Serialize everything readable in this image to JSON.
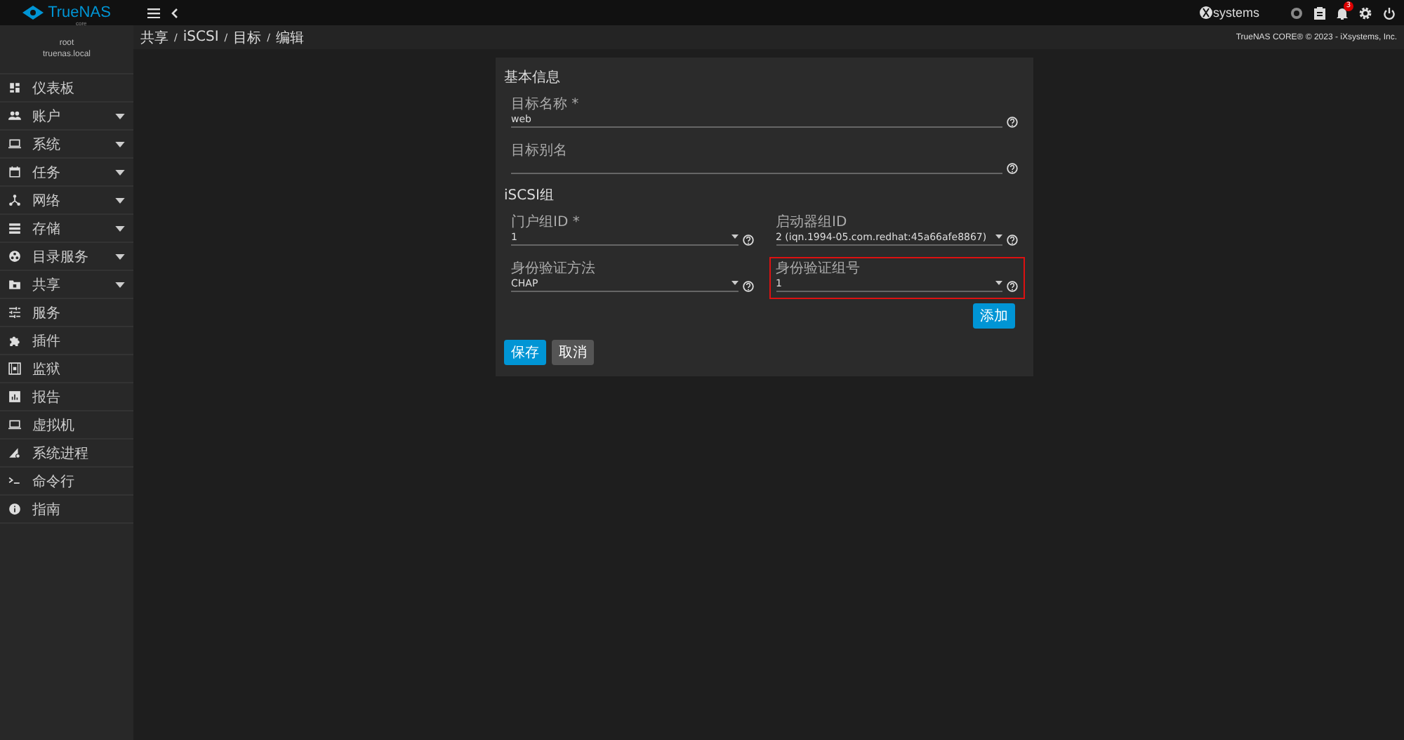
{
  "topbar": {
    "logo": "TrueNAS",
    "logo_sub": "core",
    "vendor": "systems",
    "notifications": "3"
  },
  "user": {
    "name": "root",
    "host": "truenas.local"
  },
  "sidebar": {
    "items": [
      {
        "label": "仪表板",
        "expandable": false
      },
      {
        "label": "账户",
        "expandable": true
      },
      {
        "label": "系统",
        "expandable": true
      },
      {
        "label": "任务",
        "expandable": true
      },
      {
        "label": "网络",
        "expandable": true
      },
      {
        "label": "存储",
        "expandable": true
      },
      {
        "label": "目录服务",
        "expandable": true
      },
      {
        "label": "共享",
        "expandable": true
      },
      {
        "label": "服务",
        "expandable": false
      },
      {
        "label": "插件",
        "expandable": false
      },
      {
        "label": "监狱",
        "expandable": false
      },
      {
        "label": "报告",
        "expandable": false
      },
      {
        "label": "虚拟机",
        "expandable": false
      },
      {
        "label": "系统进程",
        "expandable": false
      },
      {
        "label": "命令行",
        "expandable": false
      },
      {
        "label": "指南",
        "expandable": false
      }
    ]
  },
  "breadcrumb": [
    {
      "label": "共享",
      "separator": "/"
    },
    {
      "label": "iSCSI",
      "separator": "/"
    },
    {
      "label": "目标",
      "separator": "/"
    },
    {
      "label": "编辑"
    }
  ],
  "copyright": "TrueNAS CORE® © 2023 - iXsystems, Inc.",
  "form": {
    "sections": [
      {
        "title": "基本信息",
        "rows": [
          [
            {
              "label": "目标名称 *",
              "value": "web",
              "dropdown": false,
              "highlighted": false
            }
          ],
          [
            {
              "label": "目标别名",
              "dropdown": false,
              "highlighted": false
            }
          ]
        ]
      },
      {
        "title": "iSCSI组",
        "rows": [
          [
            {
              "label": "门户组ID *",
              "value": "1",
              "dropdown": true,
              "highlighted": false
            },
            {
              "label": "启动器组ID",
              "value": "2 (iqn.1994-05.com.redhat:45a66afe8867)",
              "dropdown": true,
              "highlighted": false
            }
          ],
          [
            {
              "label": "身份验证方法",
              "value": "CHAP",
              "dropdown": true,
              "highlighted": false
            },
            {
              "label": "身份验证组号",
              "value": "1",
              "dropdown": true,
              "highlighted": true
            }
          ]
        ]
      }
    ],
    "add_button": "添加",
    "buttons": [
      {
        "label": "保存",
        "primary": true
      },
      {
        "label": "取消",
        "primary": false
      }
    ]
  }
}
